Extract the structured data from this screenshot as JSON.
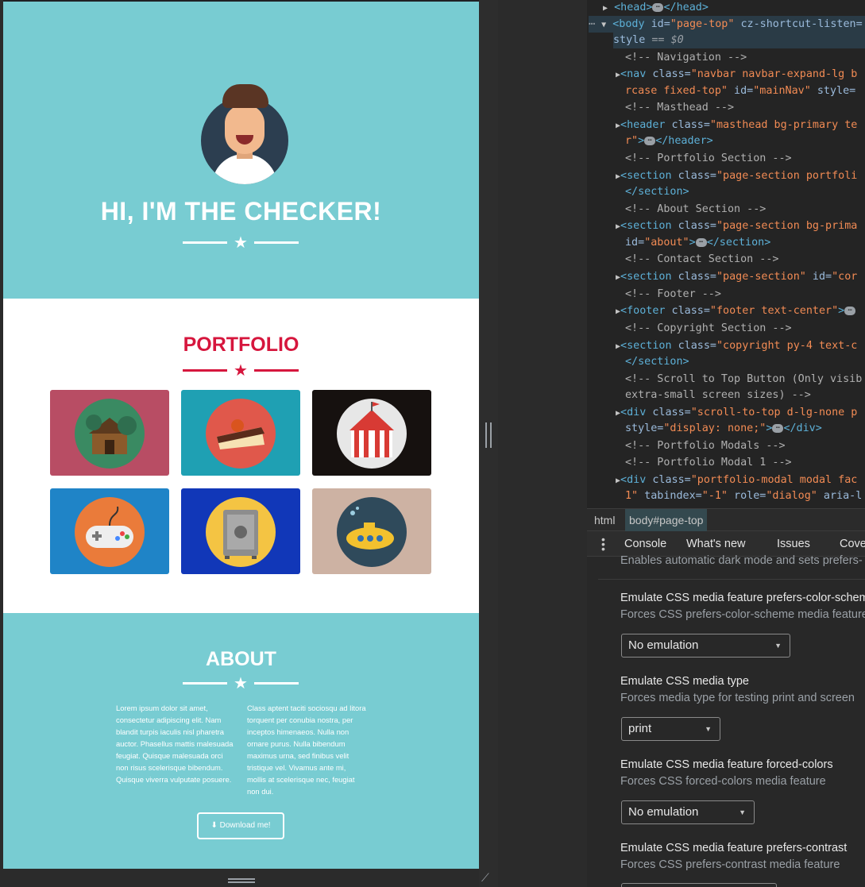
{
  "site": {
    "masthead_title": "HI, I'M THE CHECKER!",
    "portfolio_title": "PORTFOLIO",
    "portfolio_items": [
      {
        "name": "cabin",
        "bg": "#b84d64",
        "circle": "#3a8a62"
      },
      {
        "name": "cake",
        "bg": "#1fa0b3",
        "circle": "#e0584b"
      },
      {
        "name": "circus",
        "bg": "#16110f",
        "circle": "#e7e7e7"
      },
      {
        "name": "game",
        "bg": "#1f84c7",
        "circle": "#ea7b3a"
      },
      {
        "name": "safe",
        "bg": "#1137b8",
        "circle": "#f4c443"
      },
      {
        "name": "submarine",
        "bg": "#cdb2a3",
        "circle": "#2f4a5b"
      }
    ],
    "about_title": "ABOUT",
    "about_left": "Lorem ipsum dolor sit amet, consectetur adipiscing elit. Nam blandit turpis iaculis nisl pharetra auctor. Phasellus mattis malesuada feugiat. Quisque malesuada orci non risus scelerisque bibendum. Quisque viverra vulputate posuere.",
    "about_right": "Class aptent taciti sociosqu ad litora torquent per conubia nostra, per inceptos himenaeos. Nulla non ornare purus. Nulla bibendum maximus urna, sed finibus velit tristique vel. Vivamus ante mi, mollis at scelerisque nec, feugiat non dui.",
    "download_label": "Download me!",
    "colors": {
      "primary": "#78ccd2",
      "accent": "#d6163d"
    }
  },
  "devtools": {
    "code": {
      "l1_tag": "<head>",
      "l1_close": "</head>",
      "l2_open": "<body",
      "l2_id_attr": " id=",
      "l2_id_val": "\"page-top\"",
      "l2_attr2": " cz-shortcut-listen=",
      "l3_style": "style",
      "l3_eq": " == ",
      "l3_dollar": "$0",
      "c_nav": "<!-- Navigation -->",
      "nav_open": "<nav",
      "nav_class": " class=",
      "nav_val": "\"navbar navbar-expand-lg b",
      "nav2_val": "rcase fixed-top\"",
      "nav2_id": " id=",
      "nav2_idv": "\"mainNav\"",
      "nav2_style": " style=",
      "c_masthead": "<!-- Masthead -->",
      "header_open": "<header",
      "header_class": " class=",
      "header_val": "\"masthead bg-primary te",
      "header2_val": "r\"",
      "header2_close": "</header>",
      "c_portfolio": "<!-- Portfolio Section -->",
      "sec1_open": "<section",
      "sec1_class": " class=",
      "sec1_val": "\"page-section portfoli",
      "sec1_close": "</section>",
      "c_about": "<!-- About Section -->",
      "sec2_open": "<section",
      "sec2_class": " class=",
      "sec2_val": "\"page-section bg-prima",
      "sec2_id": "id=",
      "sec2_idv": "\"about\"",
      "sec2_close": "</section>",
      "c_contact": "<!-- Contact Section -->",
      "sec3_open": "<section",
      "sec3_class": " class=",
      "sec3_val": "\"page-section\"",
      "sec3_id": " id=",
      "sec3_idv": "\"cor",
      "c_footer": "<!-- Footer -->",
      "footer_open": "<footer",
      "footer_class": " class=",
      "footer_val": "\"footer text-center\"",
      "c_copyright": "<!-- Copyright Section -->",
      "sec4_open": "<section",
      "sec4_class": " class=",
      "sec4_val": "\"copyright py-4 text-c",
      "sec4_close": "</section>",
      "c_scroll1": "<!-- Scroll to Top Button (Only visib",
      "c_scroll2": "extra-small screen sizes) -->",
      "div_open": "<div",
      "div_class": " class=",
      "div_val": "\"scroll-to-top d-lg-none p",
      "div2_style": "style=",
      "div2_val": "\"display: none;\"",
      "div2_close": "</div>",
      "c_modals": "<!-- Portfolio Modals -->",
      "c_modal1": "<!-- Portfolio Modal 1 -->",
      "div3_open": "<div",
      "div3_class": " class=",
      "div3_val": "\"portfolio-modal modal fac",
      "div4_val": "1\"",
      "div4_tab": " tabindex=",
      "div4_tabv": "\"-1\"",
      "div4_role": " role=",
      "div4_rolev": "\"dialog\"",
      "div4_aria": " aria-l"
    },
    "breadcrumbs": [
      "html",
      "body#page-top"
    ],
    "drawer_tabs": [
      "Console",
      "What's new",
      "Issues",
      "Cove"
    ],
    "rendering": {
      "top_cut_text": "Enables automatic dark mode and sets prefers-",
      "items": [
        {
          "title": "Emulate CSS media feature prefers-color-schem",
          "sub": "Forces CSS prefers-color-scheme media feature",
          "value": "No emulation"
        },
        {
          "title": "Emulate CSS media type",
          "sub": "Forces media type for testing print and screen",
          "value": "print"
        },
        {
          "title": "Emulate CSS media feature forced-colors",
          "sub": "Forces CSS forced-colors media feature",
          "value": "No emulation"
        },
        {
          "title": "Emulate CSS media feature prefers-contrast",
          "sub": "Forces CSS prefers-contrast media feature",
          "value": ""
        }
      ]
    }
  }
}
